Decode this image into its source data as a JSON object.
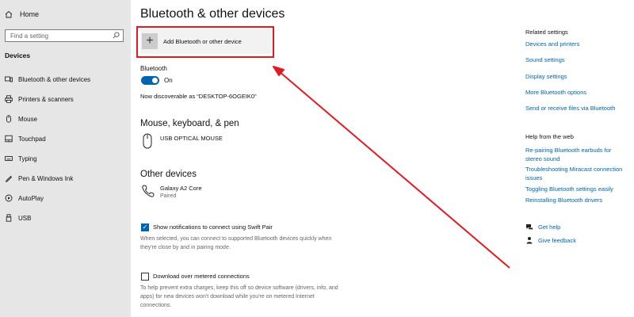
{
  "sidebar": {
    "home_label": "Home",
    "search_placeholder": "Find a setting",
    "section_heading": "Devices",
    "items": [
      {
        "label": "Bluetooth & other devices",
        "icon": "bluetooth-devices-icon"
      },
      {
        "label": "Printers & scanners",
        "icon": "printer-icon"
      },
      {
        "label": "Mouse",
        "icon": "mouse-icon"
      },
      {
        "label": "Touchpad",
        "icon": "touchpad-icon"
      },
      {
        "label": "Typing",
        "icon": "keyboard-icon"
      },
      {
        "label": "Pen & Windows Ink",
        "icon": "pen-icon"
      },
      {
        "label": "AutoPlay",
        "icon": "autoplay-icon"
      },
      {
        "label": "USB",
        "icon": "usb-icon"
      }
    ]
  },
  "main": {
    "title": "Bluetooth & other devices",
    "add_device_label": "Add Bluetooth or other device",
    "bluetooth_label": "Bluetooth",
    "bluetooth_state": "On",
    "discoverable_text": "Now discoverable as “DESKTOP-6OGEIK0”",
    "mouse_section_heading": "Mouse, keyboard, & pen",
    "mouse_device_name": "USB OPTICAL MOUSE",
    "other_section_heading": "Other devices",
    "other_device_name": "Galaxy A2 Core",
    "other_device_status": "Paired",
    "swift_pair_label": "Show notifications to connect using Swift Pair",
    "swift_pair_checked": true,
    "swift_pair_desc": "When selected, you can connect to supported Bluetooth devices quickly when they're close by and in pairing mode.",
    "metered_label": "Download over metered connections",
    "metered_checked": false,
    "metered_desc": "To help prevent extra charges, keep this off so device software (drivers, info, and apps) for new devices won't download while you're on metered Internet connections."
  },
  "related": {
    "heading": "Related settings",
    "links": [
      "Devices and printers",
      "Sound settings",
      "Display settings",
      "More Bluetooth options",
      "Send or receive files via Bluetooth"
    ],
    "help_heading": "Help from the web",
    "help_links": [
      "Re-pairing Bluetooth earbuds for stereo sound",
      "Troubleshooting Miracast connection issues",
      "Toggling Bluetooth settings easily",
      "Reinstalling Bluetooth drivers"
    ],
    "get_help": "Get help",
    "give_feedback": "Give feedback"
  },
  "colors": {
    "accent": "#0063b1",
    "annotation": "#e01b24",
    "sidebar_bg": "#e6e6e6"
  }
}
